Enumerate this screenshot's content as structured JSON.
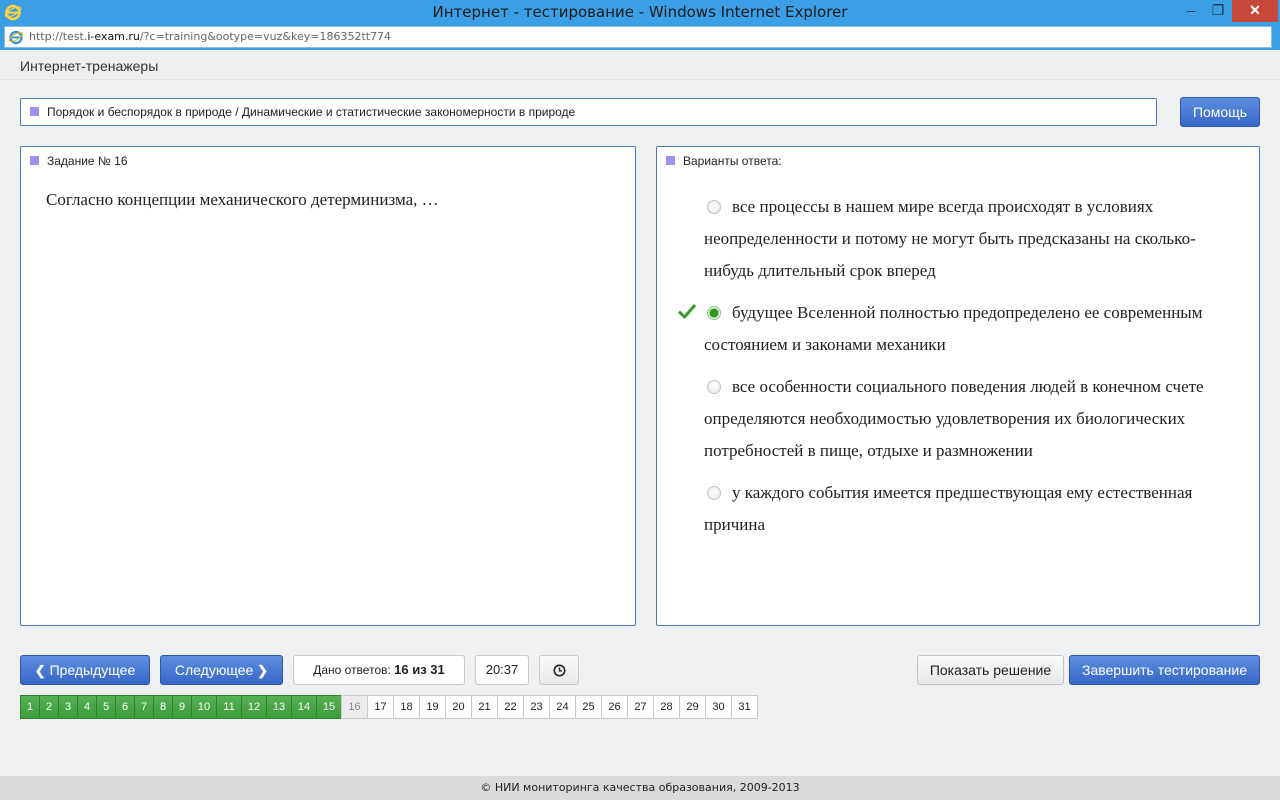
{
  "window": {
    "title": "Интернет - тестирование - Windows Internet Explorer",
    "minimize_icon": "minimize-icon",
    "maximize_icon": "restore-icon",
    "close_icon": "close-icon"
  },
  "address": {
    "url_prefix": "http://test.",
    "url_domain": "i-exam.ru",
    "url_rest": "/?c=training&ootype=vuz&key=186352tt774"
  },
  "page": {
    "brand": "Интернет-тренажеры",
    "topic": "Порядок и беспорядок в природе / Динамические и статистические закономерности в природе",
    "help_label": "Помощь"
  },
  "task": {
    "header": "Задание № 16",
    "question": "Согласно концепции механического детерминизма, …"
  },
  "answers": {
    "header": "Варианты ответа:",
    "selected_index": 1,
    "options": [
      {
        "text": "все процессы в нашем мире всегда происходят в условиях неопределенности и потому не могут быть предсказаны на сколько-нибудь длительный срок вперед",
        "selected": false
      },
      {
        "text": "будущее Вселенной полностью предопределено ее современным состоянием и законами механики",
        "selected": true
      },
      {
        "text": "все особенности социального поведения людей в конечном счете определяются необходимостью удовлетворения их биологических потребностей в пище, отдыхе и размножении",
        "selected": false
      },
      {
        "text": "у каждого события имеется предшествующая ему естественная причина",
        "selected": false
      }
    ]
  },
  "controls": {
    "prev_label": "Предыдущее",
    "next_label": "Следующее",
    "given_label": "Дано ответов:",
    "given_value": "16 из 31",
    "timer": "20:37",
    "solution_label": "Показать решение",
    "finish_label": "Завершить тестирование"
  },
  "pager": {
    "current": 16,
    "total": 31,
    "answered": [
      1,
      2,
      3,
      4,
      5,
      6,
      7,
      8,
      9,
      10,
      11,
      12,
      13,
      14,
      15
    ]
  },
  "footer": "© НИИ мониторинга качества образования, 2009-2013",
  "colors": {
    "titlebar": "#3a9fe4",
    "accent_blue": "#3866c7",
    "answered_green": "#3e9a3e",
    "bullet_square": "#9d93ef"
  }
}
